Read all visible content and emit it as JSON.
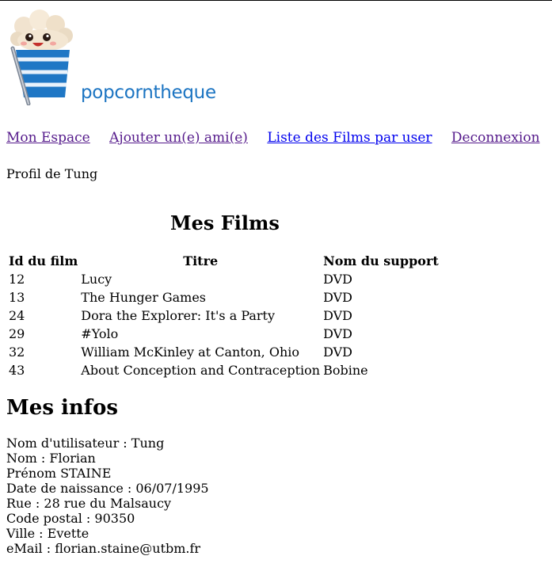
{
  "logo": {
    "text": "popcorntheque"
  },
  "nav": {
    "items": [
      {
        "label": "Mon Espace",
        "state": "visited"
      },
      {
        "label": "Ajouter un(e) ami(e)",
        "state": "visited"
      },
      {
        "label": "Liste des Films par user",
        "state": "link"
      },
      {
        "label": "Deconnexion",
        "state": "visited"
      }
    ]
  },
  "profile": {
    "title": "Profil de Tung"
  },
  "films": {
    "heading": "Mes Films",
    "columns": [
      "Id du film",
      "Titre",
      "Nom du support"
    ],
    "rows": [
      {
        "id": "12",
        "title": "Lucy",
        "support": "DVD"
      },
      {
        "id": "13",
        "title": "The Hunger Games",
        "support": "DVD"
      },
      {
        "id": "24",
        "title": "Dora the Explorer: It's a Party",
        "support": "DVD"
      },
      {
        "id": "29",
        "title": "#Yolo",
        "support": "DVD"
      },
      {
        "id": "32",
        "title": "William McKinley at Canton, Ohio",
        "support": "DVD"
      },
      {
        "id": "43",
        "title": "About Conception and Contraception",
        "support": "Bobine"
      }
    ]
  },
  "infos": {
    "heading": "Mes infos",
    "lines": [
      "Nom d'utilisateur : Tung",
      "Nom : Florian",
      "Prénom STAINE",
      "Date de naissance : 06/07/1995",
      "Rue : 28 rue du Malsaucy",
      "Code postal : 90350",
      "Ville : Evette",
      "eMail : florian.staine@utbm.fr"
    ]
  },
  "colors": {
    "link": "#0000ee",
    "visited": "#551a8b",
    "brand": "#1b74c2"
  }
}
